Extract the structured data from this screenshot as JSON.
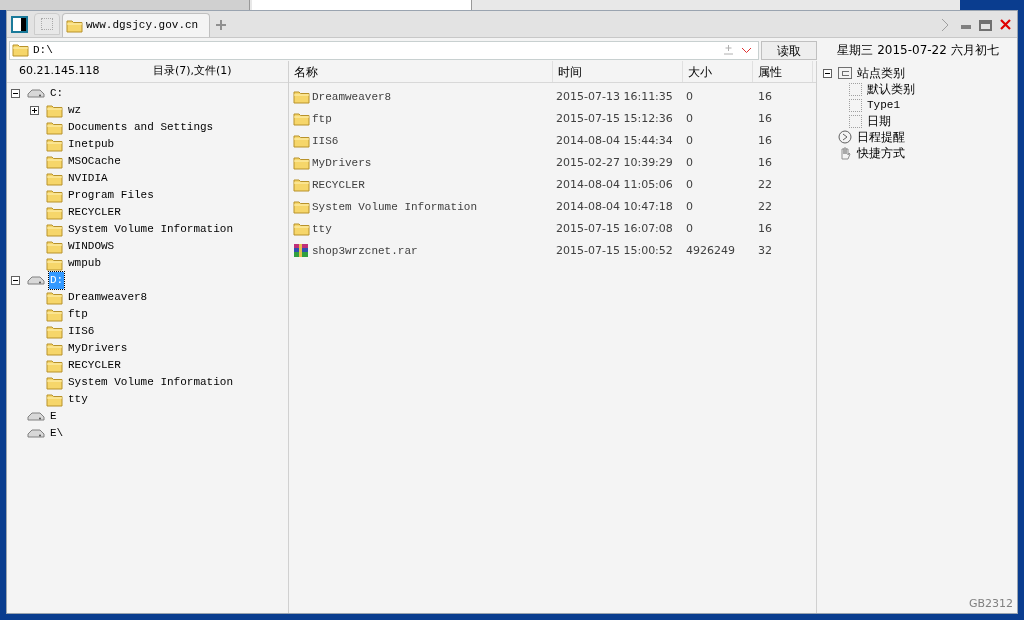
{
  "tab": {
    "title": "www.dgsjcy.gov.cn",
    "selected": true
  },
  "address": {
    "value": "D:\\",
    "button": "读取"
  },
  "date_line": "星期三 2015-07-22 六月初七",
  "left_header": {
    "ip": "60.21.145.118",
    "summary": "目录(7),文件(1)"
  },
  "tree": [
    {
      "label": "C:",
      "kind": "drive",
      "expanded": true,
      "selected": false,
      "children": [
        {
          "label": "wz",
          "kind": "folder",
          "expanded": false,
          "selected": false
        },
        {
          "label": "Documents and Settings",
          "kind": "folder",
          "selected": false
        },
        {
          "label": "Inetpub",
          "kind": "folder",
          "selected": false
        },
        {
          "label": "MSOCache",
          "kind": "folder",
          "selected": false
        },
        {
          "label": "NVIDIA",
          "kind": "folder",
          "selected": false
        },
        {
          "label": "Program Files",
          "kind": "folder",
          "selected": false
        },
        {
          "label": "RECYCLER",
          "kind": "folder",
          "selected": false
        },
        {
          "label": "System Volume Information",
          "kind": "folder",
          "selected": false
        },
        {
          "label": "WINDOWS",
          "kind": "folder",
          "selected": false
        },
        {
          "label": "wmpub",
          "kind": "folder",
          "selected": false
        }
      ]
    },
    {
      "label": "D:",
      "kind": "drive",
      "expanded": true,
      "selected": true,
      "children": [
        {
          "label": "Dreamweaver8",
          "kind": "folder",
          "selected": false
        },
        {
          "label": "ftp",
          "kind": "folder",
          "selected": false
        },
        {
          "label": "IIS6",
          "kind": "folder",
          "selected": false
        },
        {
          "label": "MyDrivers",
          "kind": "folder",
          "selected": false
        },
        {
          "label": "RECYCLER",
          "kind": "folder",
          "selected": false
        },
        {
          "label": "System Volume Information",
          "kind": "folder",
          "selected": false
        },
        {
          "label": "tty",
          "kind": "folder",
          "selected": false
        }
      ]
    },
    {
      "label": "E",
      "kind": "drive",
      "selected": false
    },
    {
      "label": "E\\",
      "kind": "drive",
      "selected": false
    }
  ],
  "files": {
    "columns": [
      "名称",
      "时间",
      "大小",
      "属性"
    ],
    "rows": [
      {
        "kind": "folder",
        "name": "Dreamweaver8",
        "time": "2015-07-13 16:11:35",
        "size": "0",
        "attr": "16"
      },
      {
        "kind": "folder",
        "name": "ftp",
        "time": "2015-07-15 15:12:36",
        "size": "0",
        "attr": "16"
      },
      {
        "kind": "folder",
        "name": "IIS6",
        "time": "2014-08-04 15:44:34",
        "size": "0",
        "attr": "16"
      },
      {
        "kind": "folder",
        "name": "MyDrivers",
        "time": "2015-02-27 10:39:29",
        "size": "0",
        "attr": "16"
      },
      {
        "kind": "folder",
        "name": "RECYCLER",
        "time": "2014-08-04 11:05:06",
        "size": "0",
        "attr": "22"
      },
      {
        "kind": "folder",
        "name": "System Volume Information",
        "time": "2014-08-04 10:47:18",
        "size": "0",
        "attr": "22"
      },
      {
        "kind": "folder",
        "name": "tty",
        "time": "2015-07-15 16:07:08",
        "size": "0",
        "attr": "16"
      },
      {
        "kind": "archive",
        "name": "shop3wrzcnet.rar",
        "time": "2015-07-15 15:00:52",
        "size": "4926249",
        "attr": "32"
      }
    ]
  },
  "side_tree": [
    {
      "label": "站点类别",
      "kind": "category",
      "expanded": true,
      "children": [
        {
          "label": "默认类别",
          "kind": "type"
        },
        {
          "label": "Type1",
          "kind": "type"
        },
        {
          "label": "日期",
          "kind": "type"
        }
      ]
    },
    {
      "label": "日程提醒",
      "kind": "schedule"
    },
    {
      "label": "快捷方式",
      "kind": "shortcut"
    }
  ],
  "status": "GB2312"
}
